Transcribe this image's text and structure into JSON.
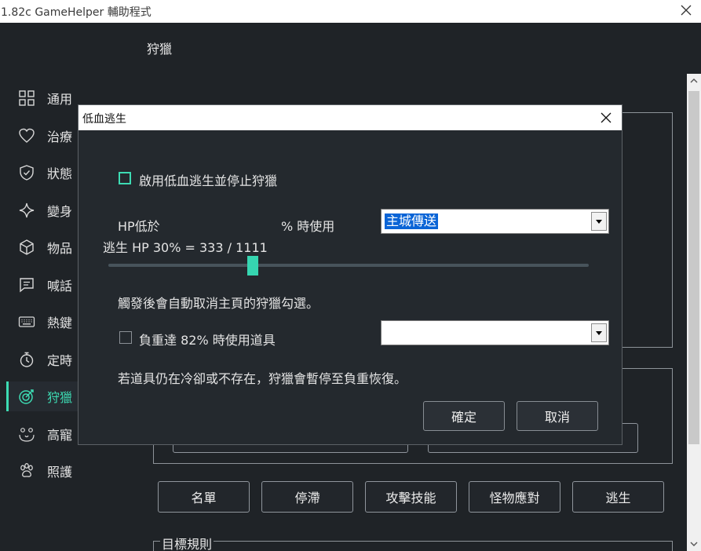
{
  "window": {
    "title": "1.82c GameHelper 輔助程式"
  },
  "page": {
    "title": "狩獵"
  },
  "sidebar": {
    "items": [
      {
        "label": "通用",
        "icon": "grid-icon"
      },
      {
        "label": "治療",
        "icon": "heart-icon"
      },
      {
        "label": "狀態",
        "icon": "shield-icon"
      },
      {
        "label": "變身",
        "icon": "sparkle-icon"
      },
      {
        "label": "物品",
        "icon": "cube-icon"
      },
      {
        "label": "喊話",
        "icon": "chat-icon"
      },
      {
        "label": "熱鍵",
        "icon": "keyboard-icon"
      },
      {
        "label": "定時",
        "icon": "timer-icon"
      },
      {
        "label": "狩獵",
        "icon": "target-icon",
        "active": true
      },
      {
        "label": "高寵",
        "icon": "pet-face-icon"
      },
      {
        "label": "照護",
        "icon": "paw-icon"
      }
    ],
    "accent_color": "#3ddbb3"
  },
  "hunt": {
    "buttons": [
      "名單",
      "停滯",
      "攻擊技能",
      "怪物應對",
      "逃生"
    ],
    "target_rules_title": "目標規則"
  },
  "dialog": {
    "title": "低血逃生",
    "enable_label": "啟用低血逃生並停止狩獵",
    "hp_label": "HP低於",
    "use_label": "% 時使用",
    "action_selected": "主城傳送",
    "escape_hp_text": "逃生 HP  30% = 333 / 1111",
    "slider_percent": 30,
    "note_uncheck": "觸發後會自動取消主頁的狩獵勾選。",
    "weight_label": "負重達 82% 時使用道具",
    "weight_item_selected": "",
    "note_cooldown": "若道具仍在冷卻或不存在，狩獵會暫停至負重恢復。",
    "ok_label": "確定",
    "cancel_label": "取消"
  }
}
